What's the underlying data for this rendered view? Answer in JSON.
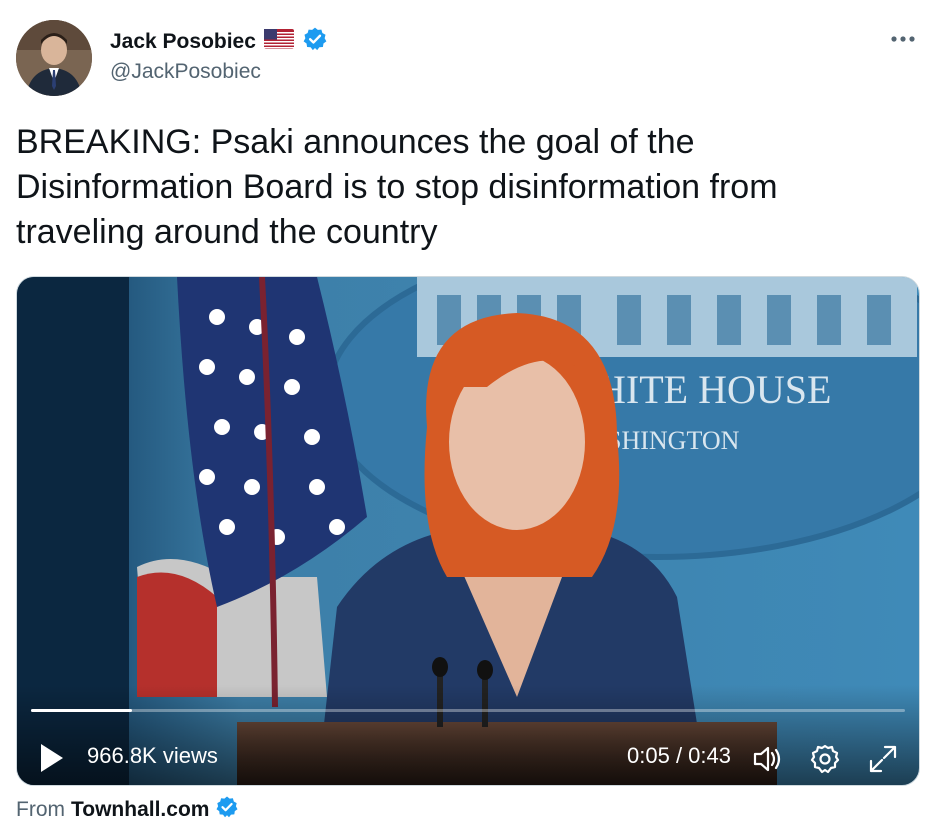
{
  "author": {
    "name": "Jack Posobiec",
    "handle": "@JackPosobiec",
    "flag_icon": "us-flag-icon",
    "verified_icon": "verified-badge-icon"
  },
  "tweet": {
    "text": "BREAKING: Psaki announces the goal of the Disinformation Board is to stop disinformation from traveling around the country"
  },
  "video": {
    "backdrop_line1": "HITE HOUSE",
    "backdrop_line2": "SHINGTON",
    "views": "966.8K views",
    "time": "0:05 / 0:43",
    "progress_fraction": 0.116,
    "icons": [
      "play-icon",
      "volume-icon",
      "settings-icon",
      "fullscreen-icon"
    ]
  },
  "source": {
    "prefix": "From",
    "link": "Townhall.com"
  },
  "colors": {
    "verified": "#1d9bf0",
    "text": "#0f1419",
    "secondary": "#536471"
  }
}
